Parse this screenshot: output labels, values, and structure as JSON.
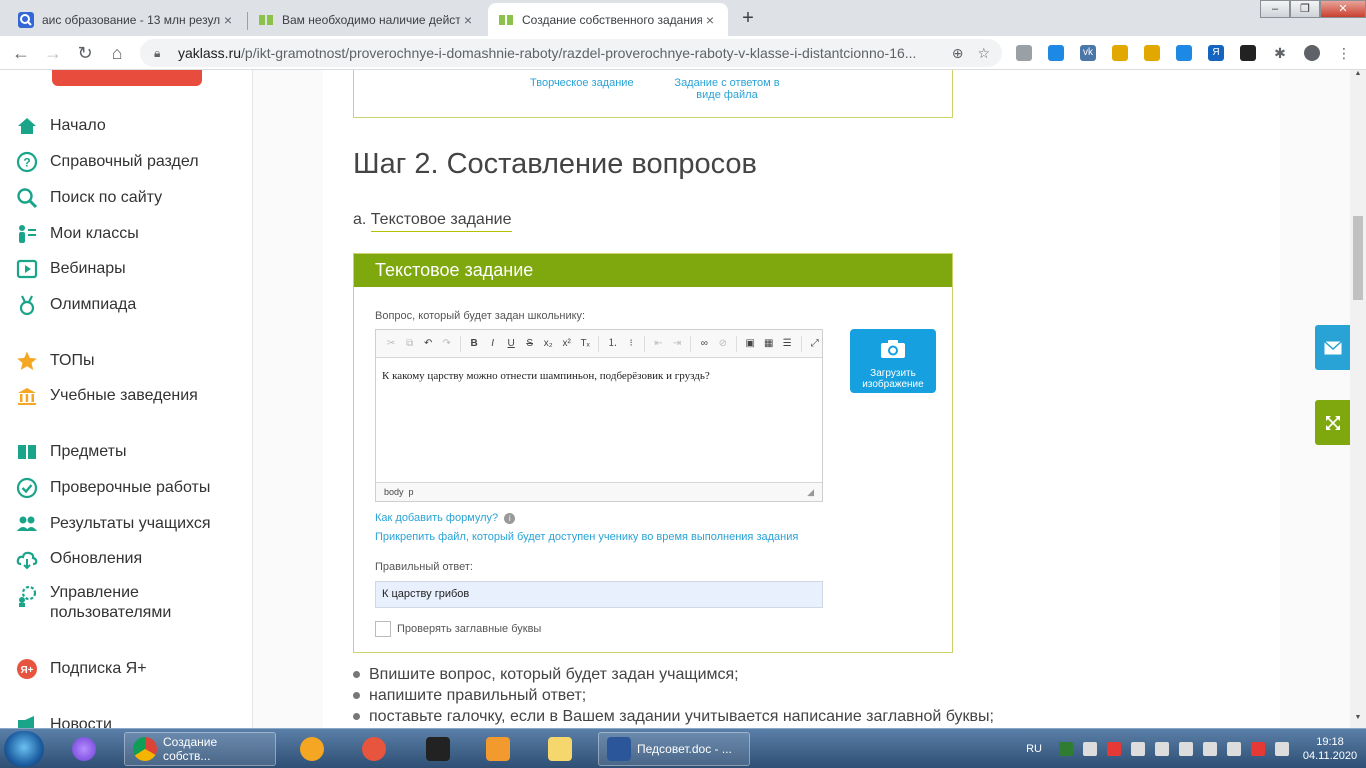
{
  "browser": {
    "tabs": [
      {
        "title": "аис образование - 13 млн резул",
        "favicon_color": "#4285f4",
        "active": false
      },
      {
        "title": "Вам необходимо наличие дейст",
        "favicon_color": "#8bc34a",
        "active": false
      },
      {
        "title": "Создание собственного задания",
        "favicon_color": "#8bc34a",
        "active": true
      }
    ],
    "new_tab_label": "+",
    "close_label": "×",
    "url_host": "yaklass.ru",
    "url_path": "/p/ikt-gramotnost/proverochnye-i-domashnie-raboty/razdel-proverochnye-raboty-v-klasse-i-distantcionno-16..."
  },
  "sidebar": {
    "items": [
      {
        "label": "Начало",
        "icon": "home-icon"
      },
      {
        "label": "Справочный раздел",
        "icon": "help-icon"
      },
      {
        "label": "Поиск по сайту",
        "icon": "search-icon"
      },
      {
        "label": "Мои классы",
        "icon": "classes-icon"
      },
      {
        "label": "Вебинары",
        "icon": "webinar-icon"
      },
      {
        "label": "Олимпиада",
        "icon": "medal-icon"
      },
      {
        "label": "ТОПы",
        "icon": "star-icon"
      },
      {
        "label": "Учебные заведения",
        "icon": "school-icon"
      },
      {
        "label": "Предметы",
        "icon": "book-icon"
      },
      {
        "label": "Проверочные работы",
        "icon": "check-icon"
      },
      {
        "label": "Результаты учащихся",
        "icon": "users-icon"
      },
      {
        "label": "Обновления",
        "icon": "cloud-icon"
      },
      {
        "label": "Управление",
        "label2": "пользователями",
        "icon": "gear-users-icon"
      },
      {
        "label": "Подписка Я+",
        "icon": "subscription-icon"
      },
      {
        "label": "Новости",
        "icon": "news-icon"
      }
    ]
  },
  "content": {
    "prev_links": [
      "Творческое задание",
      "Задание с ответом в",
      "виде файла"
    ],
    "step_title": "Шаг 2. Составление вопросов",
    "sub_prefix": "а. ",
    "sub_link": "Текстовое задание",
    "card": {
      "header": "Текстовое задание",
      "question_label": "Вопрос, который будет задан школьнику:",
      "question_text": "К какому царству можно отнести шампиньон, подберёзовик и груздь?",
      "status_body": "body",
      "status_p": "p",
      "upload_line1": "Загрузить",
      "upload_line2": "изображение",
      "formula_link": "Как добавить формулу?",
      "attach_link": "Прикрепить файл, который будет доступен ученику во время выполнения задания",
      "answer_label": "Правильный ответ:",
      "answer_value": "К царству грибов",
      "checkbox_label": "Проверять заглавные буквы"
    },
    "bullets": [
      "Впишите вопрос, который будет задан учащимся;",
      "напишите правильный ответ;",
      "поставьте галочку, если в Вашем задании учитывается написание заглавной буквы;"
    ]
  },
  "taskbar": {
    "chrome_window": "Создание собств...",
    "word_window": "Педсовет.doc - ...",
    "lang": "RU",
    "time": "19:18",
    "date": "04.11.2020"
  },
  "colors": {
    "accent_green": "#7fa80f",
    "link_blue": "#29a3d6",
    "upload_blue": "#17a0df",
    "sidebar_icon": "#1aa58b"
  }
}
